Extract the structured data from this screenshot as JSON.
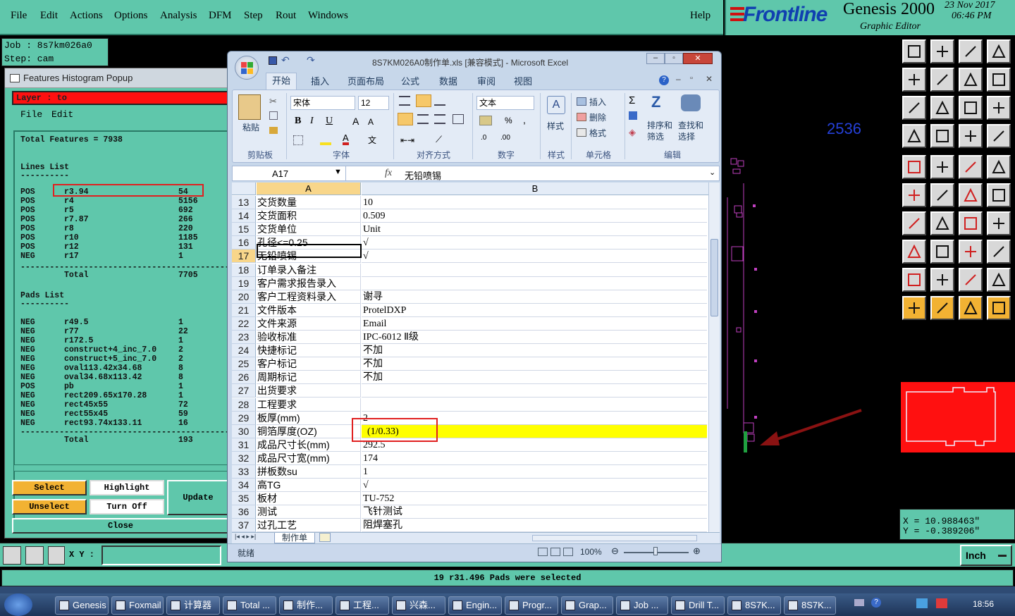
{
  "genesis": {
    "menu": [
      "File",
      "Edit",
      "Actions",
      "Options",
      "Analysis",
      "DFM",
      "Step",
      "Rout",
      "Windows"
    ],
    "help": "Help",
    "brand": "Frontline",
    "product": "Genesis 2000",
    "subtitle": "Graphic Editor",
    "date": "23  Nov  2017",
    "time": "06:46  PM",
    "job": "Job : 8s7km026a0",
    "step": "Step: cam",
    "canvas_number": "2536",
    "coord_x": "X = 10.988463\"",
    "coord_y": "Y = -0.389206\"",
    "xy_label": "X Y :",
    "units": "Inch",
    "status_message": "19 r31.496 Pads were selected"
  },
  "histogram": {
    "title": "Features Histogram Popup",
    "layer": "Layer :  to",
    "menu_file": "File",
    "menu_edit": "Edit",
    "total_features": "Total Features = 7938",
    "lines_heading": "Lines List",
    "underline": "----------",
    "lines": [
      {
        "pol": "POS",
        "sym": "r3.94",
        "count": "54"
      },
      {
        "pol": "POS",
        "sym": "r4",
        "count": "5156"
      },
      {
        "pol": "POS",
        "sym": "r5",
        "count": "692"
      },
      {
        "pol": "POS",
        "sym": "r7.87",
        "count": "266"
      },
      {
        "pol": "POS",
        "sym": "r8",
        "count": "220"
      },
      {
        "pol": "POS",
        "sym": "r10",
        "count": "1185"
      },
      {
        "pol": "POS",
        "sym": "r12",
        "count": "131"
      },
      {
        "pol": "NEG",
        "sym": "r17",
        "count": "1"
      }
    ],
    "separator": "-------------------------------------------",
    "total_label": "Total",
    "lines_total": "7705",
    "pads_heading": "Pads List",
    "pads": [
      {
        "pol": "NEG",
        "sym": "r49.5",
        "count": "1"
      },
      {
        "pol": "NEG",
        "sym": "r77",
        "count": "22"
      },
      {
        "pol": "NEG",
        "sym": "r172.5",
        "count": "1"
      },
      {
        "pol": "NEG",
        "sym": "construct+4_inc_7.0",
        "count": "2"
      },
      {
        "pol": "NEG",
        "sym": "construct+5_inc_7.0",
        "count": "2"
      },
      {
        "pol": "NEG",
        "sym": "oval113.42x34.68",
        "count": "8"
      },
      {
        "pol": "NEG",
        "sym": "oval34.68x113.42",
        "count": "8"
      },
      {
        "pol": "POS",
        "sym": "pb",
        "count": "1"
      },
      {
        "pol": "NEG",
        "sym": "rect209.65x170.28",
        "count": "1"
      },
      {
        "pol": "NEG",
        "sym": "rect45x55",
        "count": "72"
      },
      {
        "pol": "NEG",
        "sym": "rect55x45",
        "count": "59"
      },
      {
        "pol": "NEG",
        "sym": "rect93.74x133.11",
        "count": "16"
      }
    ],
    "pads_total": "193",
    "buttons": {
      "select": "Select",
      "highlight": "Highlight",
      "update": "Update",
      "unselect": "Unselect",
      "turn_off": "Turn Off",
      "close": "Close"
    }
  },
  "excel": {
    "title": "8S7KM026A0制作单.xls  [兼容模式] - Microsoft Excel",
    "tabs": [
      "开始",
      "插入",
      "页面布局",
      "公式",
      "数据",
      "审阅",
      "视图"
    ],
    "font_name": "宋体",
    "font_size": "12",
    "number_format": "文本",
    "groups": [
      "剪贴板",
      "字体",
      "对齐方式",
      "数字",
      "样式",
      "单元格",
      "编辑"
    ],
    "paste": "粘贴",
    "style": "样式",
    "cells_cmds": [
      "插入",
      "删除",
      "格式"
    ],
    "sort": "排序和\n筛选",
    "find": "查找和\n选择",
    "name_box": "A17",
    "fx": "fx",
    "formula": "无铅喷锡",
    "col_a": "A",
    "col_b": "B",
    "rows": [
      {
        "n": "13",
        "a": "交货数量",
        "b": "10"
      },
      {
        "n": "14",
        "a": "交货面积",
        "b": "0.509"
      },
      {
        "n": "15",
        "a": "交货单位",
        "b": "Unit"
      },
      {
        "n": "16",
        "a": "孔径<=0.25",
        "b": "√"
      },
      {
        "n": "17",
        "a": "无铅喷锡",
        "b": "√"
      },
      {
        "n": "18",
        "a": "订单录入备注",
        "b": ""
      },
      {
        "n": "19",
        "a": "客户需求报告录入",
        "b": ""
      },
      {
        "n": "20",
        "a": "客户工程资料录入",
        "b": "谢寻"
      },
      {
        "n": "21",
        "a": "文件版本",
        "b": "ProtelDXP"
      },
      {
        "n": "22",
        "a": "文件来源",
        "b": "Email"
      },
      {
        "n": "23",
        "a": "验收标准",
        "b": "IPC-6012 Ⅱ级"
      },
      {
        "n": "24",
        "a": "快捷标记",
        "b": "不加"
      },
      {
        "n": "25",
        "a": "客户标记",
        "b": "不加"
      },
      {
        "n": "26",
        "a": "周期标记",
        "b": "不加"
      },
      {
        "n": "27",
        "a": "出货要求",
        "b": ""
      },
      {
        "n": "28",
        "a": "工程要求",
        "b": ""
      },
      {
        "n": "29",
        "a": "板厚(mm)",
        "b": "2"
      },
      {
        "n": "30",
        "a": "铜箔厚度(OZ)",
        "b": "(1/0.33)"
      },
      {
        "n": "31",
        "a": "成品尺寸长(mm)",
        "b": "292.5"
      },
      {
        "n": "32",
        "a": "成品尺寸宽(mm)",
        "b": "174"
      },
      {
        "n": "33",
        "a": "拼板数su",
        "b": "1"
      },
      {
        "n": "34",
        "a": "高TG",
        "b": "√"
      },
      {
        "n": "35",
        "a": "板材",
        "b": "TU-752"
      },
      {
        "n": "36",
        "a": "测试",
        "b": "飞针测试"
      },
      {
        "n": "37",
        "a": "过孔工艺",
        "b": "阻焊塞孔"
      }
    ],
    "sheet_tab": "制作单",
    "status": "就绪",
    "zoom": "100%"
  },
  "taskbar": {
    "items": [
      "Genesis",
      "Foxmail",
      "计算器",
      "Total ...",
      "制作...",
      "工程...",
      "兴森...",
      "Engin...",
      "Progr...",
      "Grap...",
      "Job ...",
      "Drill T...",
      "8S7K...",
      "8S7K..."
    ],
    "clock": "18:56"
  }
}
